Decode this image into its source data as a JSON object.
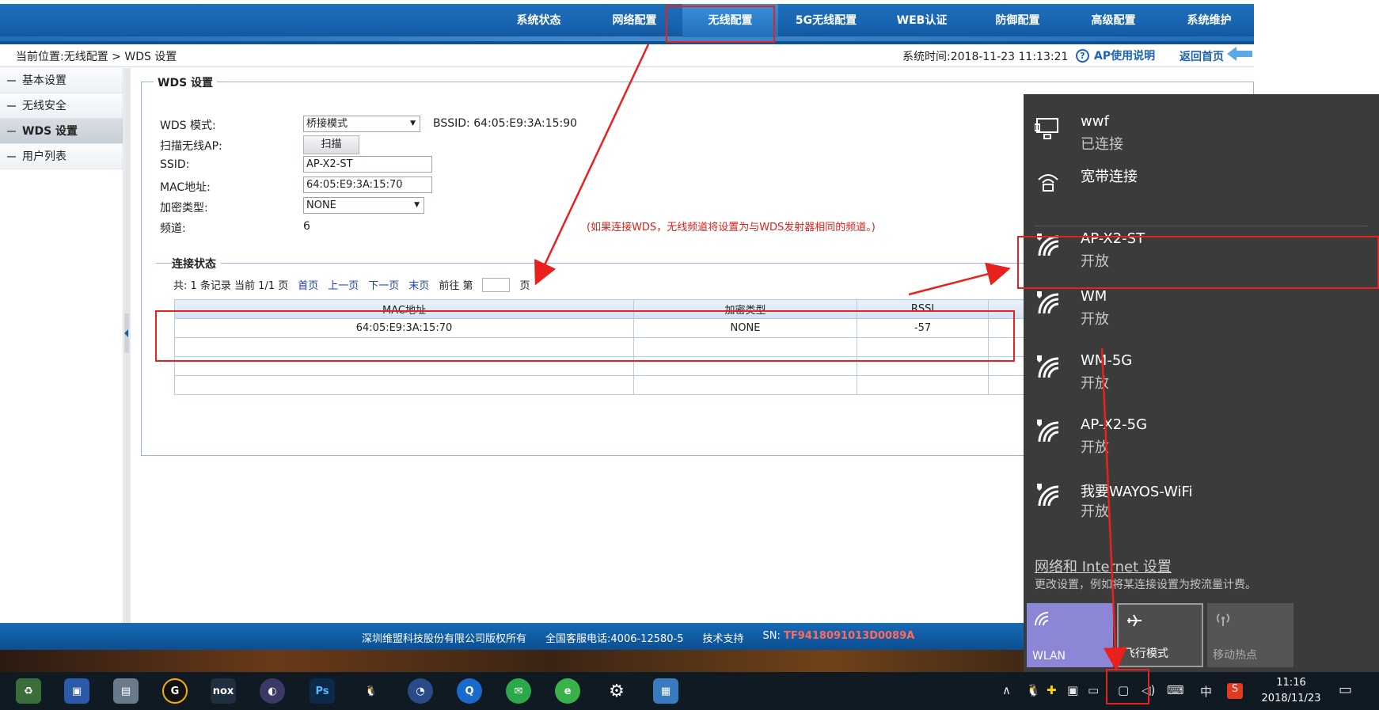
{
  "nav": {
    "items": [
      "系统状态",
      "网络配置",
      "无线配置",
      "5G无线配置",
      "WEB认证",
      "防御配置",
      "高级配置",
      "系统维护"
    ],
    "active": "无线配置"
  },
  "crumb": {
    "breadcrumb": "当前位置:无线配置 > WDS 设置",
    "system_time": "系统时间:2018-11-23 11:13:21",
    "help_label": "AP使用说明",
    "home_label": "返回首页"
  },
  "sidebar": {
    "items": [
      {
        "label": "基本设置"
      },
      {
        "label": "无线安全"
      },
      {
        "label": "WDS 设置",
        "active": true
      },
      {
        "label": "用户列表"
      }
    ]
  },
  "wds": {
    "legend": "WDS 设置",
    "mode_label": "WDS 模式:",
    "mode_value": "桥接模式",
    "bssid_text": "BSSID: 64:05:E9:3A:15:90",
    "scan_label": "扫描无线AP:",
    "scan_button": "扫描",
    "ssid_label": "SSID:",
    "ssid_value": "AP-X2-ST",
    "mac_label": "MAC地址:",
    "mac_value": "64:05:E9:3A:15:70",
    "enc_label": "加密类型:",
    "enc_value": "NONE",
    "channel_label": "频道:",
    "channel_value": "6",
    "note": "(如果连接WDS，无线频道将设置为与WDS发射器相同的频道。)"
  },
  "conn": {
    "title": "连接状态",
    "summary": "共: 1 条记录 当前 1/1 页",
    "first": "首页",
    "prev": "上一页",
    "next": "下一页",
    "last": "末页",
    "goto_prefix": "前往 第",
    "goto_suffix": "页",
    "columns": [
      "MAC地址",
      "加密类型",
      "RSSI"
    ],
    "rows": [
      [
        "64:05:E9:3A:15:70",
        "NONE",
        "-57"
      ]
    ]
  },
  "footer": {
    "copyright": "深圳维盟科技股份有限公司版权所有",
    "phone": "全国客服电话:4006-12580-5",
    "support": "技术支持",
    "sn_label": "SN:",
    "sn_value": "TF9418091013D0089A"
  },
  "flyout": {
    "networks": [
      {
        "name": "wwf",
        "status": "已连接",
        "icon": "ethernet-icon"
      },
      {
        "name": "宽带连接",
        "status": "",
        "icon": "dialup-icon"
      },
      {
        "name": "AP-X2-ST",
        "status": "开放",
        "icon": "wifi-open-icon"
      },
      {
        "name": "WM",
        "status": "开放",
        "icon": "wifi-open-icon"
      },
      {
        "name": "WM-5G",
        "status": "开放",
        "icon": "wifi-open-icon"
      },
      {
        "name": "AP-X2-5G",
        "status": "开放",
        "icon": "wifi-open-icon"
      },
      {
        "name": "我要WAYOS-WiFi",
        "status": "开放",
        "icon": "wifi-open-icon"
      }
    ],
    "settings_link": "网络和 Internet 设置",
    "settings_sub": "更改设置，例如将某连接设置为按流量计费。",
    "quick_actions": [
      {
        "label": "WLAN",
        "icon": "wifi-icon"
      },
      {
        "label": "飞行模式",
        "icon": "airplane-icon"
      },
      {
        "label": "移动热点",
        "icon": "hotspot-icon"
      }
    ]
  },
  "taskbar": {
    "ime": "中",
    "time": "11:16",
    "date": "2018/11/23"
  },
  "colors": {
    "nav_blue": "#1763ae",
    "annotation_red": "#e8211c",
    "flyout_bg": "#3b3b3b",
    "wlan_tile": "#8b86d6"
  }
}
